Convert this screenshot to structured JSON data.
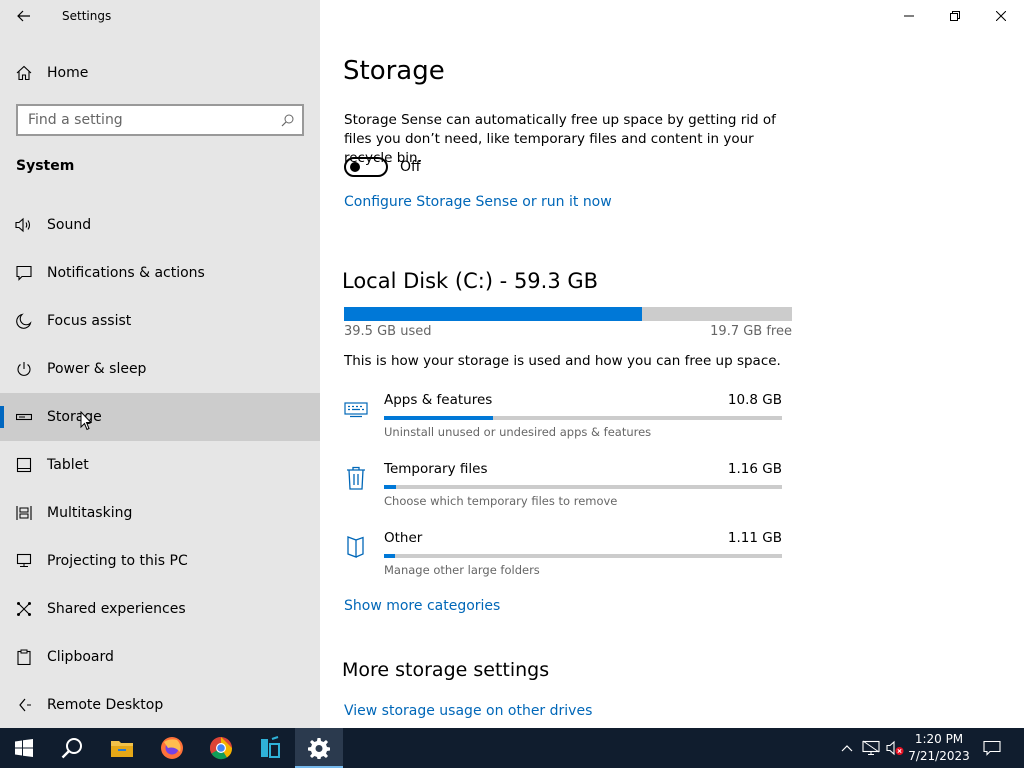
{
  "window": {
    "title": "Settings",
    "accent": "#0078d7"
  },
  "sidebar": {
    "home_label": "Home",
    "search_placeholder": "Find a setting",
    "section_label": "System",
    "items": [
      {
        "label": "Sound",
        "icon": "speaker-icon",
        "selected": false
      },
      {
        "label": "Notifications & actions",
        "icon": "notification-icon",
        "selected": false
      },
      {
        "label": "Focus assist",
        "icon": "moon-icon",
        "selected": false
      },
      {
        "label": "Power & sleep",
        "icon": "power-icon",
        "selected": false
      },
      {
        "label": "Storage",
        "icon": "storage-drive-icon",
        "selected": true
      },
      {
        "label": "Tablet",
        "icon": "tablet-icon",
        "selected": false
      },
      {
        "label": "Multitasking",
        "icon": "multitasking-icon",
        "selected": false
      },
      {
        "label": "Projecting to this PC",
        "icon": "projecting-icon",
        "selected": false
      },
      {
        "label": "Shared experiences",
        "icon": "shared-experiences-icon",
        "selected": false
      },
      {
        "label": "Clipboard",
        "icon": "clipboard-icon",
        "selected": false
      },
      {
        "label": "Remote Desktop",
        "icon": "remote-desktop-icon",
        "selected": false
      }
    ]
  },
  "main": {
    "title": "Storage",
    "storage_sense_desc": "Storage Sense can automatically free up space by getting rid of files you don’t need, like temporary files and content in your recycle bin.",
    "toggle_state": "Off",
    "toggle_on": false,
    "configure_link": "Configure Storage Sense or run it now",
    "disk": {
      "title": "Local Disk (C:) - 59.3 GB",
      "used": "39.5 GB used",
      "free": "19.7 GB free",
      "used_fraction": 0.666
    },
    "usage_desc": "This is how your storage is used and how you can free up space.",
    "categories": [
      {
        "name": "Apps & features",
        "size": "10.8 GB",
        "desc": "Uninstall unused or undesired apps & features",
        "icon": "apps-features-icon",
        "fraction": 0.275
      },
      {
        "name": "Temporary files",
        "size": "1.16 GB",
        "desc": "Choose which temporary files to remove",
        "icon": "trash-icon",
        "fraction": 0.03
      },
      {
        "name": "Other",
        "size": "1.11 GB",
        "desc": "Manage other large folders",
        "icon": "folder-icon",
        "fraction": 0.028
      }
    ],
    "show_more": "Show more categories",
    "more_settings_title": "More storage settings",
    "view_other_drives": "View storage usage on other drives"
  },
  "taskbar": {
    "apps": [
      "start-icon",
      "search-icon",
      "file-explorer-icon",
      "firefox-icon",
      "chrome-icon",
      "app-icon",
      "settings-icon"
    ],
    "time": "1:20 PM",
    "date": "7/21/2023"
  }
}
